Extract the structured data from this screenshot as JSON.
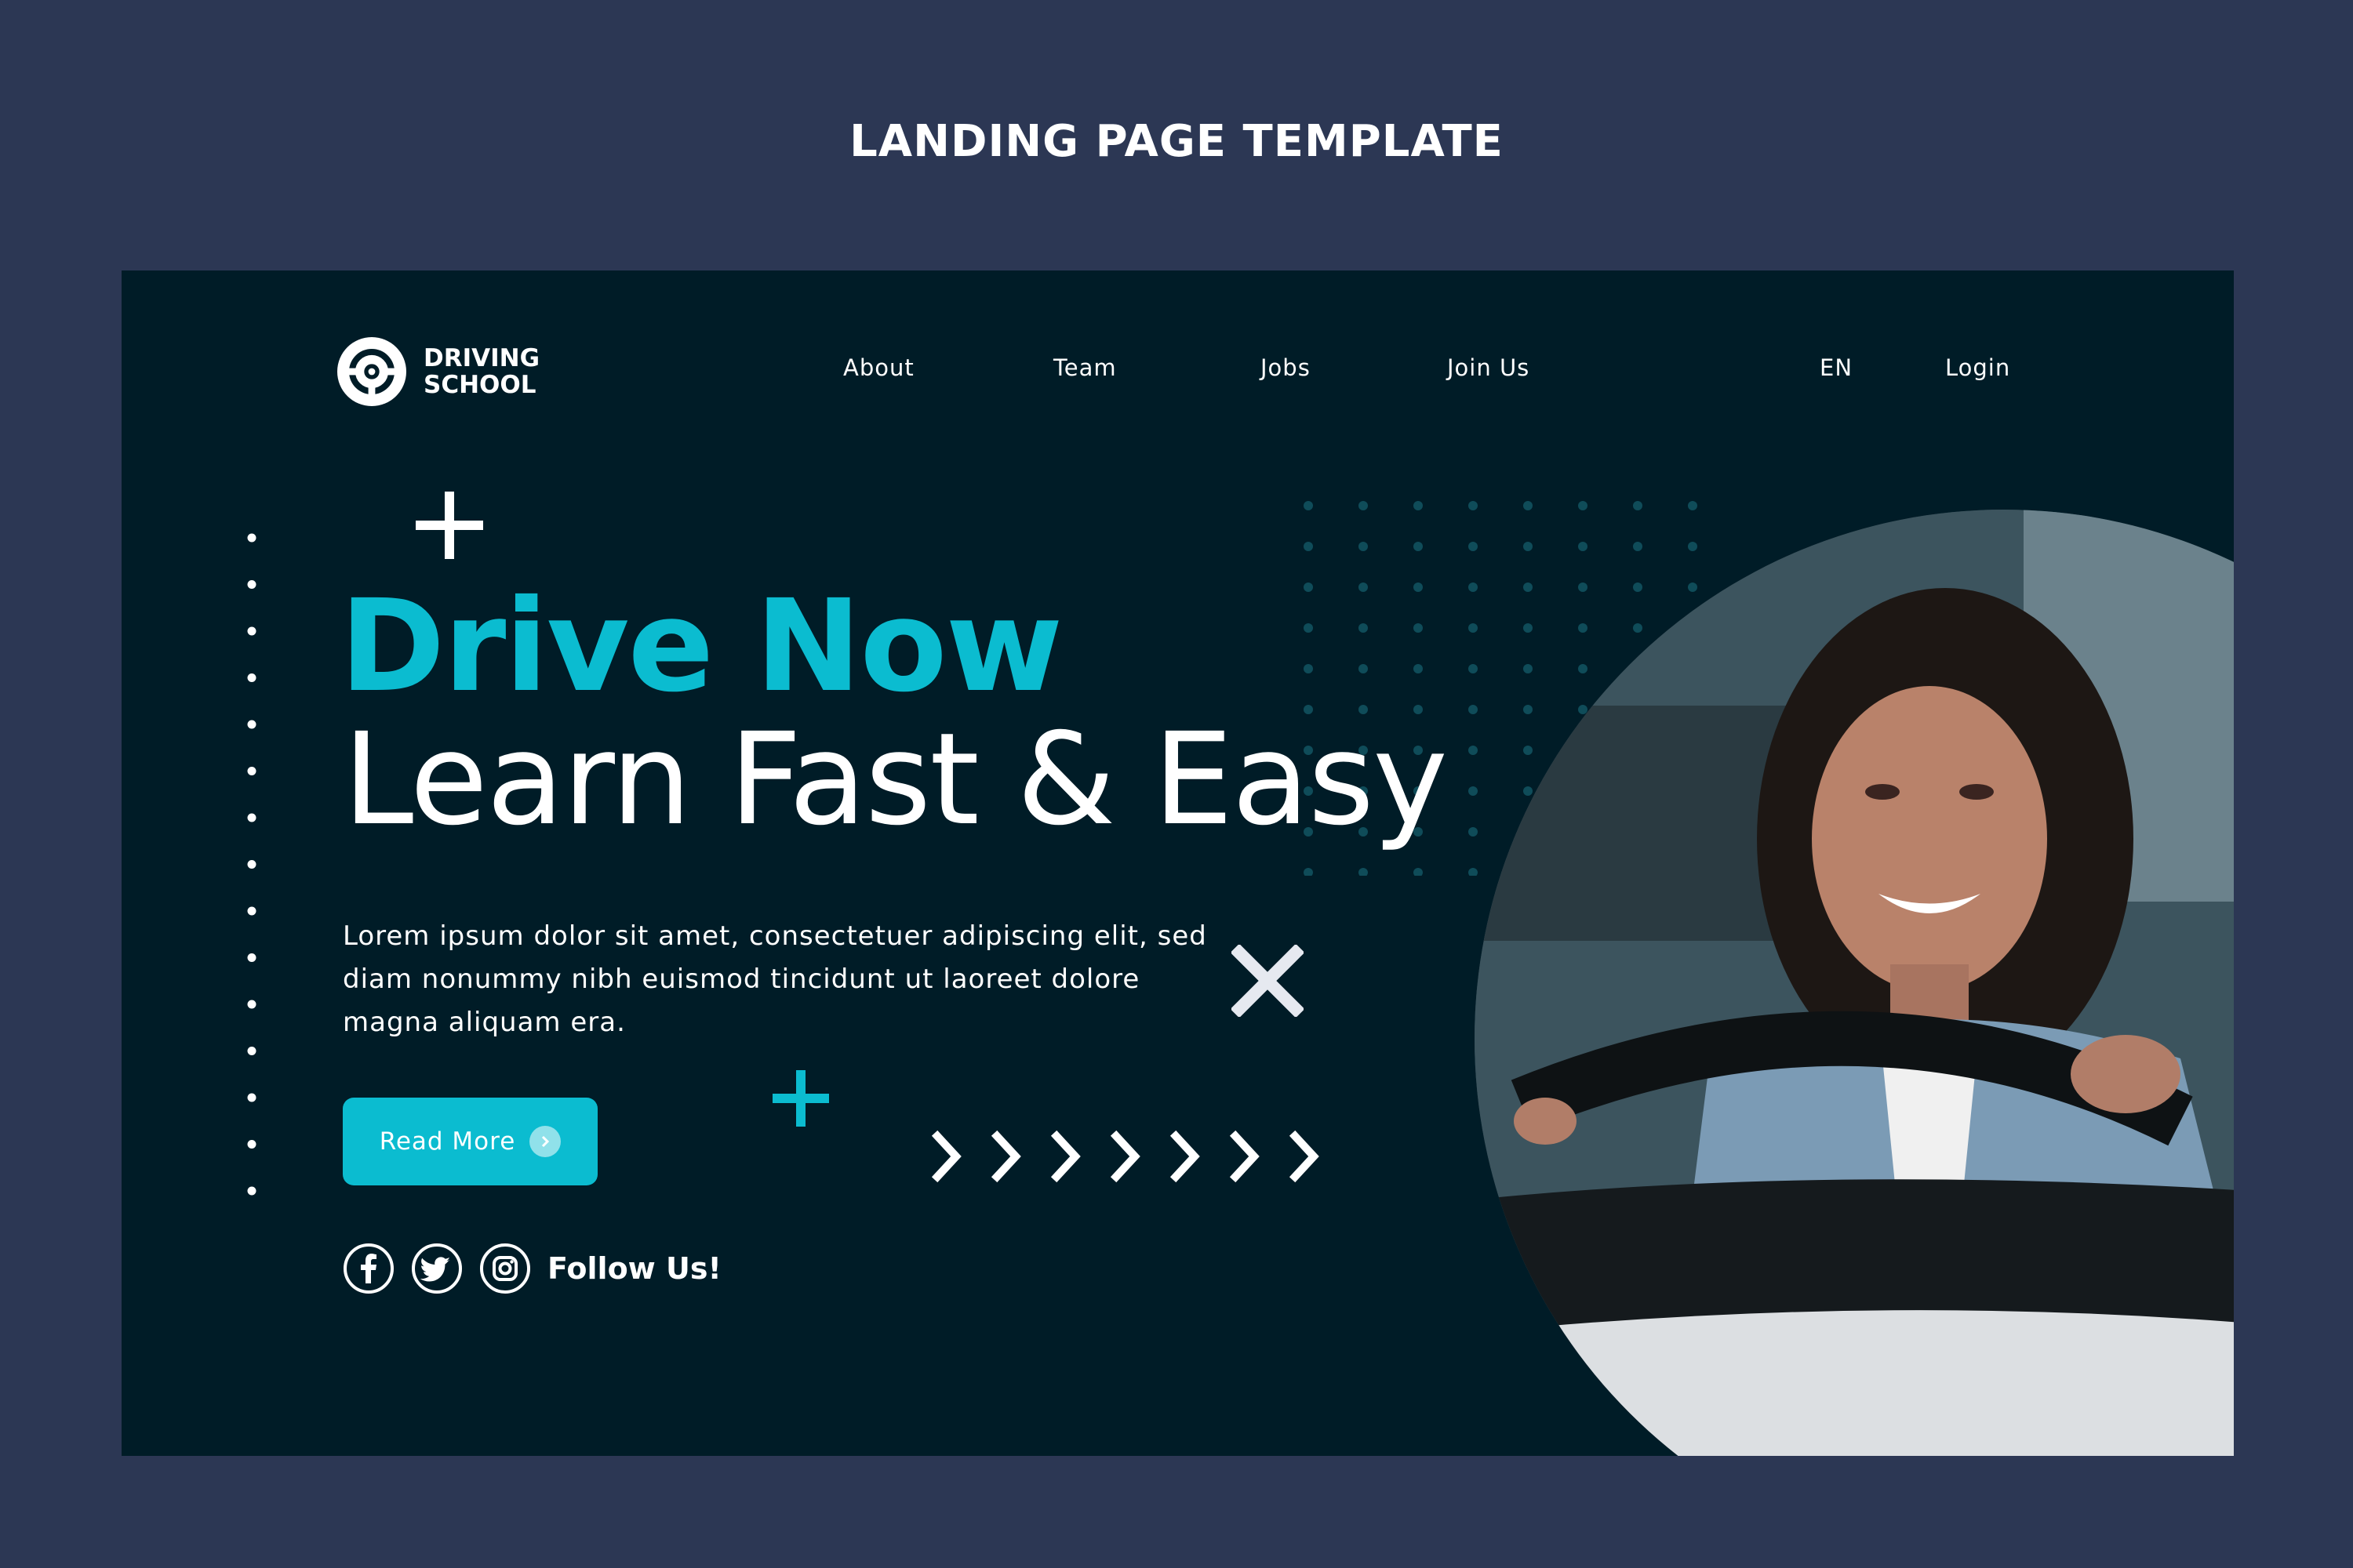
{
  "page": {
    "template_title": "LANDING PAGE TEMPLATE"
  },
  "header": {
    "logo_line1": "DRIVING",
    "logo_line2": "SCHOOL",
    "nav": [
      "About",
      "Team",
      "Jobs",
      "Join Us"
    ],
    "language": "EN",
    "login": "Login"
  },
  "hero": {
    "headline_accent": "Drive Now",
    "headline_main": "Learn Fast & Easy",
    "body": "Lorem ipsum dolor sit amet, consectetuer adipiscing elit, sed diam nonummy nibh euismod tincidunt ut laoreet dolore magna aliquam era.",
    "cta_label": "Read More",
    "follow_label": "Follow Us!"
  },
  "colors": {
    "background": "#2c3754",
    "panel": "#001c27",
    "accent": "#0bbcd0",
    "text": "#ffffff"
  },
  "icons": {
    "logo": "steering-wheel-icon",
    "cta": "chevron-right-icon",
    "social": [
      "facebook-icon",
      "twitter-icon",
      "instagram-icon"
    ]
  }
}
